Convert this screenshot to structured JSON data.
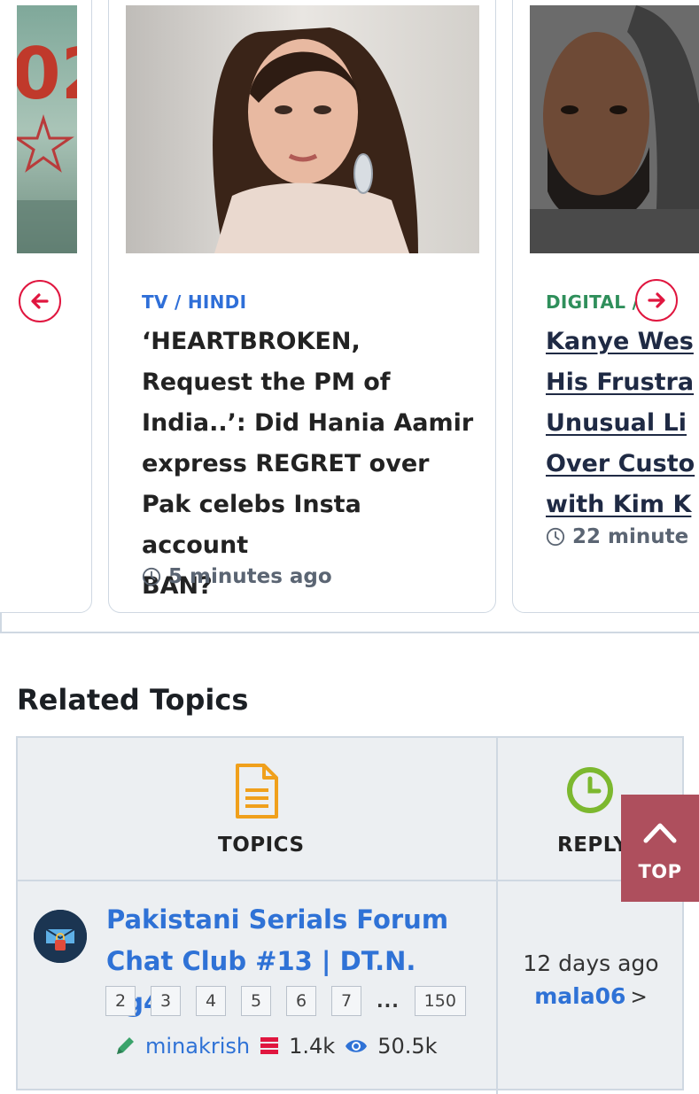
{
  "carousel": {
    "cards": [
      {
        "category": "TV / HINDI",
        "headline_lines": [
          "‘HEARTBROKEN,",
          "Request the PM of",
          "India..’: Did Hania Aamir",
          "express REGRET over",
          "Pak celebs Insta account",
          "BAN?"
        ],
        "time": "5 minutes ago"
      },
      {
        "category": "DIGITAL /",
        "headline_lines": [
          "Kanye Wes",
          "His Frustra",
          "Unusual Li",
          "Over Custo",
          "with Kim K"
        ],
        "time": "22 minute"
      }
    ],
    "prev_icon": "arrow-left-icon",
    "next_icon": "arrow-right-icon",
    "accent_color": "#e0163f"
  },
  "related": {
    "title": "Related Topics",
    "columns": {
      "topics": "TOPICS",
      "reply": "REPLY"
    },
    "rows": [
      {
        "title": "Pakistani Serials Forum Chat Club #13 | DT.N. Pg49",
        "pages": [
          "2",
          "3",
          "4",
          "5",
          "6",
          "7"
        ],
        "ellipsis": "...",
        "last_page": "150",
        "author": "minakrish",
        "replies": "1.4k",
        "views": "50.5k",
        "last_reply_time": "12 days ago",
        "last_reply_user": "mala06",
        "last_reply_arrow": ">"
      }
    ]
  },
  "top_button": {
    "label": "TOP",
    "icon": "chevron-up-icon",
    "color": "#ae4f5d"
  }
}
